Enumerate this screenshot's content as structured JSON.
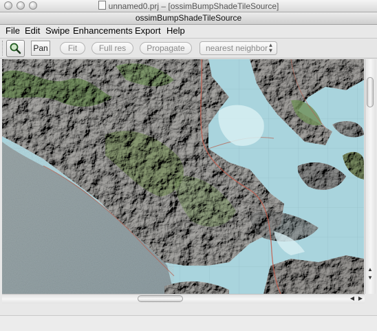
{
  "window": {
    "title": "unnamed0.prj – [ossimBumpShadeTileSource]",
    "inner_title": "ossimBumpShadeTileSource"
  },
  "menu": [
    "File",
    "Edit",
    "Swipe",
    "Enhancements",
    "Export",
    "Help"
  ],
  "toolbar": {
    "zoom_icon": "magnifier-icon",
    "pan_label": "Pan",
    "fit_label": "Fit",
    "fullres_label": "Full res",
    "propagate_label": "Propagate",
    "resampling_value": "nearest neighbor"
  },
  "scrollbars": {
    "up_arrow": "▲",
    "down_arrow": "▼",
    "left_arrow": "◀",
    "right_arrow": "▶"
  },
  "colors": {
    "water": "#a9d4dd",
    "land": "#a9a8a5",
    "vegetation": "#6f8f58"
  }
}
